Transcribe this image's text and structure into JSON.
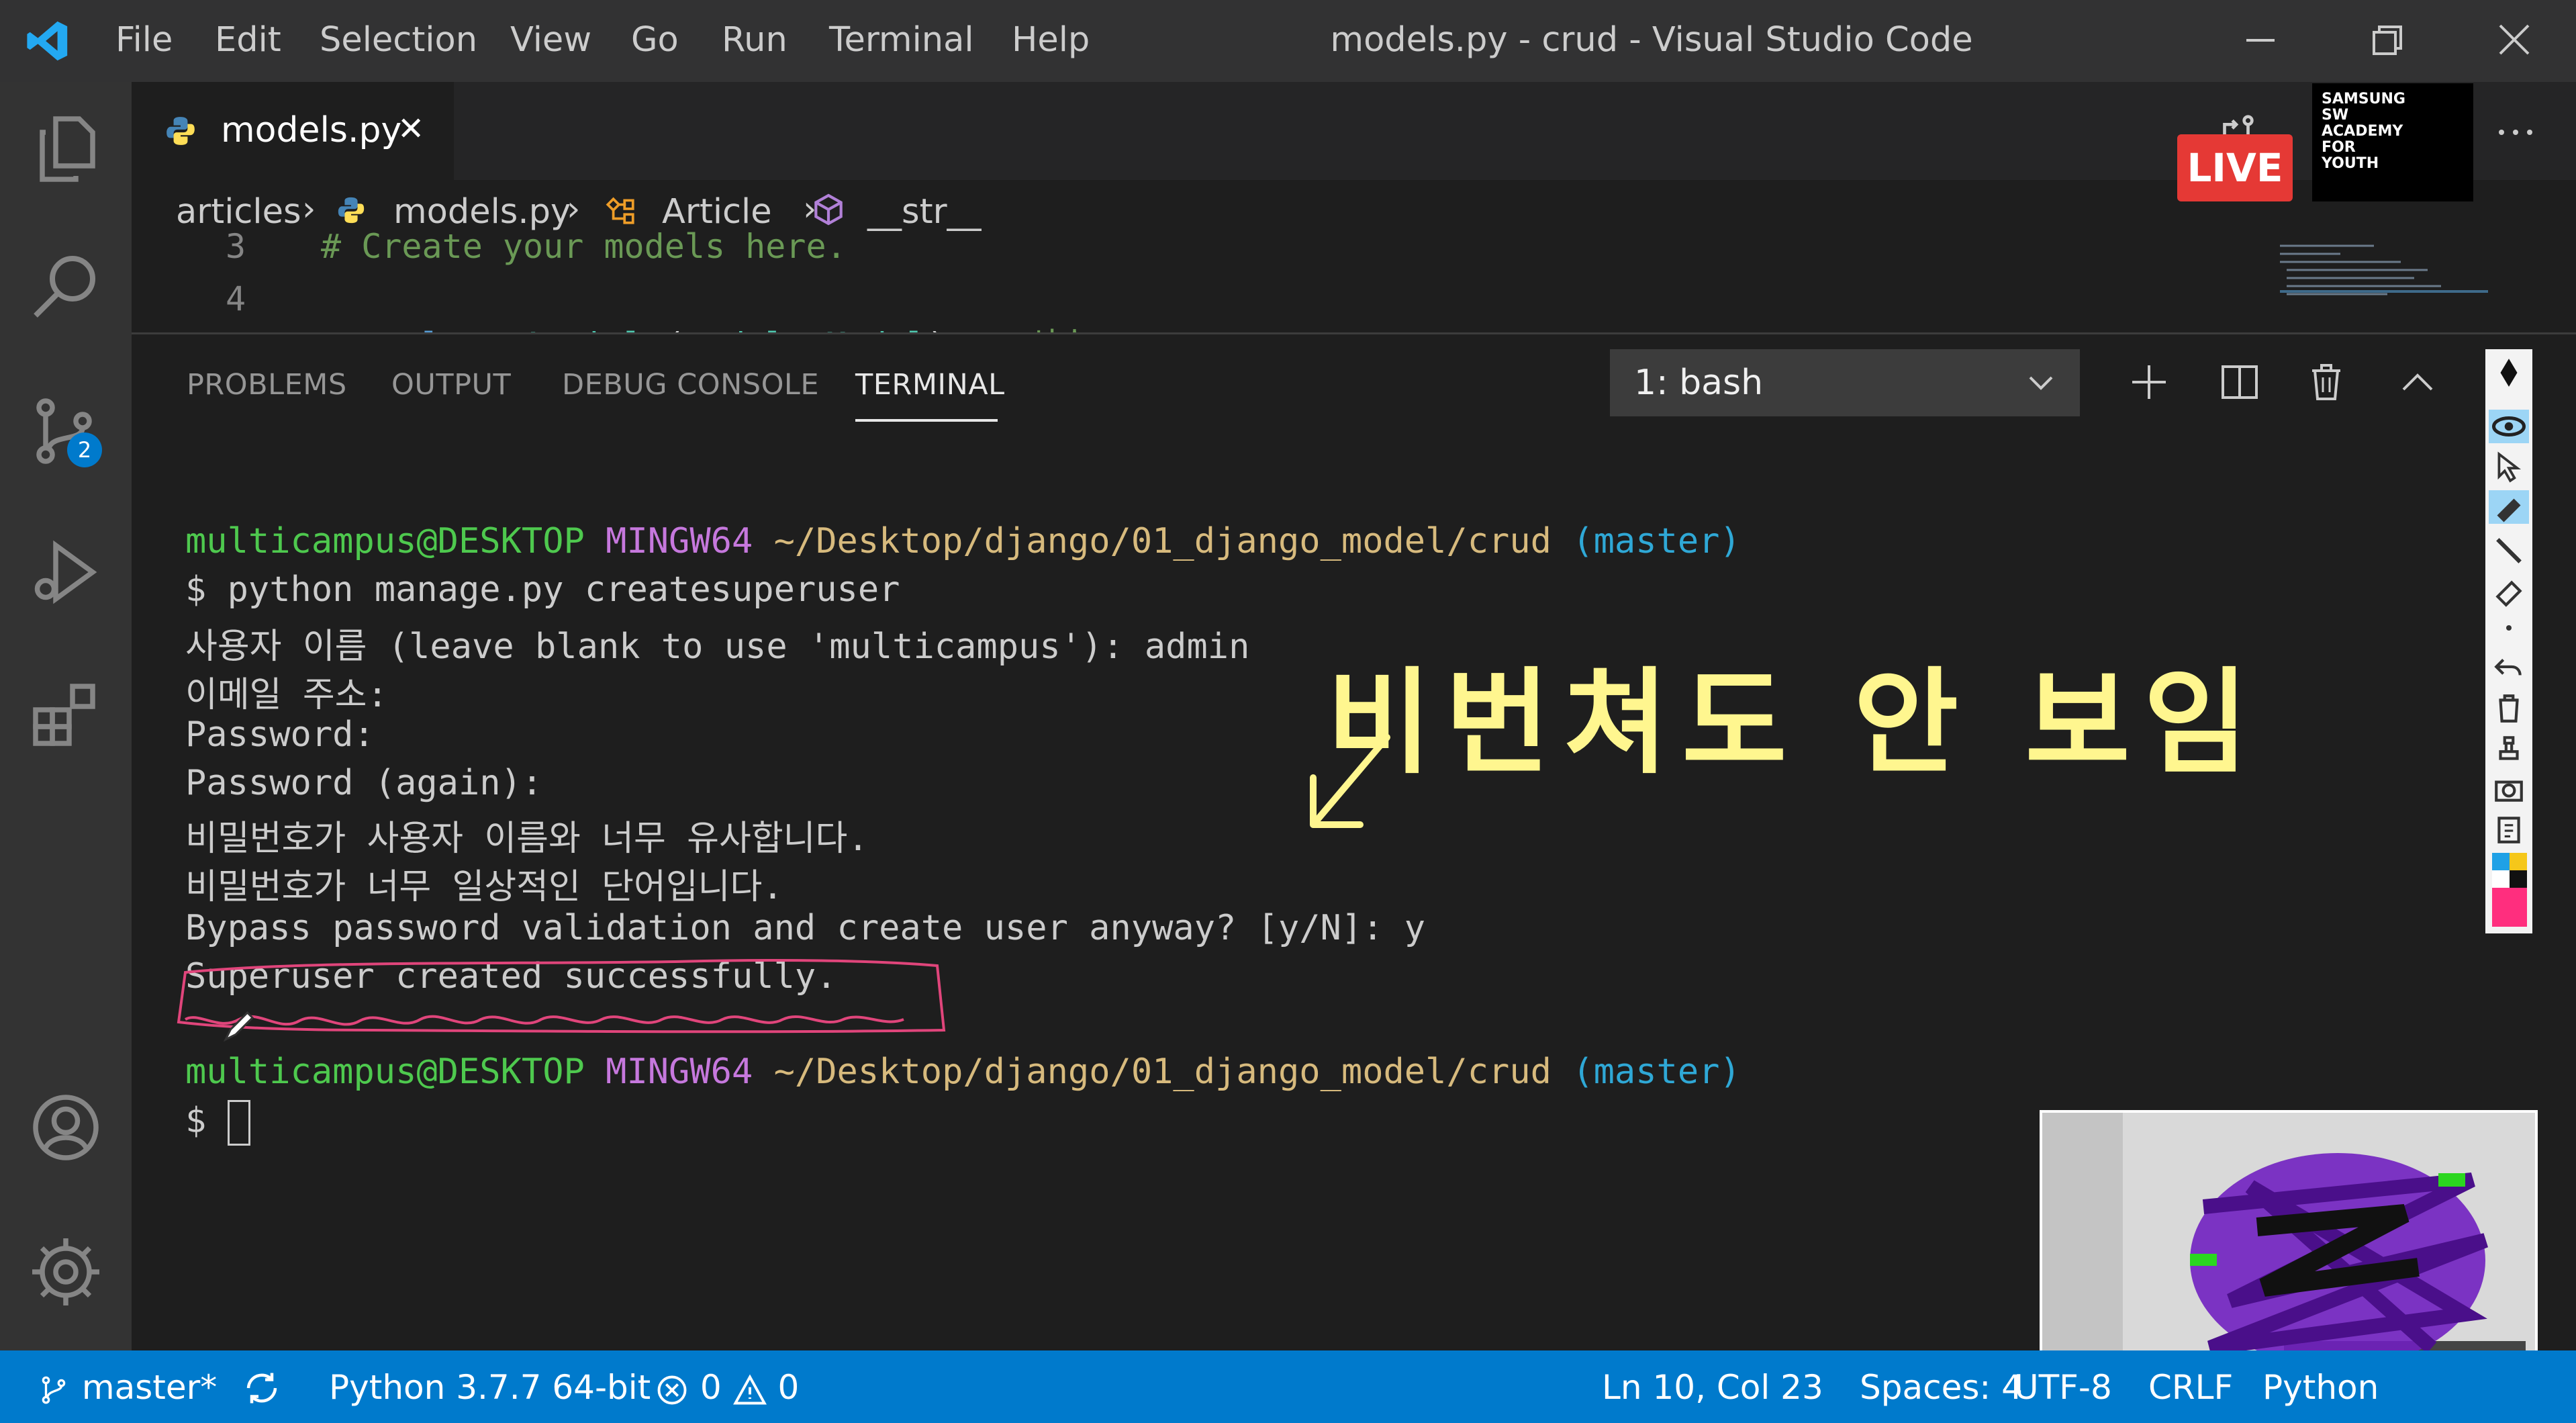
{
  "menu": [
    "File",
    "Edit",
    "Selection",
    "View",
    "Go",
    "Run",
    "Terminal",
    "Help"
  ],
  "window_title": "models.py - crud - Visual Studio Code",
  "activity_bar": {
    "source_control_badge": "2"
  },
  "tab": {
    "label": "models.py",
    "close": "✕"
  },
  "breadcrumb": [
    "articles",
    "models.py",
    "Article",
    "__str__"
  ],
  "editor_lines": [
    {
      "number": "3",
      "comment": "# Create your models here."
    },
    {
      "number": "4",
      "kw": "class",
      "cls": "Article",
      "paren_open": "(",
      "base": "models.Model",
      "paren_close": "):",
      "comment": "# 상속"
    }
  ],
  "panel_tabs": [
    "PROBLEMS",
    "OUTPUT",
    "DEBUG CONSOLE",
    "TERMINAL"
  ],
  "terminal_select": "1: bash",
  "prompt": {
    "user": "multicampus@DESKTOP",
    "env": "MINGW64",
    "path": "~/Desktop/django/01_django_model/crud",
    "branch": "(master)"
  },
  "terminal_lines": [
    "$ python manage.py createsuperuser",
    "사용자 이름 (leave blank to use 'multicampus'): admin",
    "이메일 주소:",
    "Password:",
    "Password (again):",
    "비밀번호가 사용자 이름와 너무 유사합니다.",
    "비밀번호가 너무 일상적인 단어입니다.",
    "Bypass password validation and create user anyway? [y/N]: y",
    "Superuser created successfully."
  ],
  "prompt_symbol": "$",
  "annotation": "비번쳐도 안 보임",
  "live_badge": "LIVE",
  "ssafy_logo": [
    "SAMSUNG",
    "SW",
    "ACADEMY",
    "FOR",
    "YOUTH"
  ],
  "status": {
    "branch": "master*",
    "python": "Python 3.7.7 64-bit",
    "errors": "0",
    "warnings": "0",
    "position": "Ln 10, Col 23",
    "spaces": "Spaces: 4",
    "encoding": "UTF-8",
    "eol": "CRLF",
    "language": "Python"
  },
  "colors": {
    "accent": "#007acc",
    "live": "#e53935",
    "annotation": "#fff68f",
    "highlight_pen": "#e0457b"
  }
}
